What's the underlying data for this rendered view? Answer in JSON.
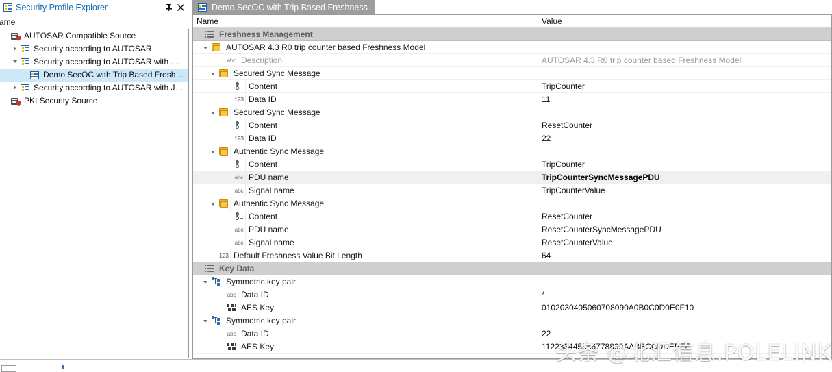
{
  "left_dock": {
    "title": "Security Profile Explorer",
    "title_icon": "security-profile-icon",
    "pin_glyph": "█",
    "close_glyph": "✕",
    "column_header": "ame",
    "tree": [
      {
        "label": "AUTOSAR Compatible Source",
        "icon": "source-icon",
        "indent": 0,
        "twisty": "none",
        "selected": false
      },
      {
        "label": "Security according to AUTOSAR",
        "icon": "profile-icon",
        "indent": 1,
        "twisty": "closed",
        "selected": false
      },
      {
        "label": "Security according to AUTOSAR with …",
        "icon": "profile-icon",
        "indent": 1,
        "twisty": "open",
        "selected": false
      },
      {
        "label": "Demo SecOC with  Trip Based Fresh…",
        "icon": "profile-leaf-icon",
        "indent": 2,
        "twisty": "none",
        "selected": true
      },
      {
        "label": "Security according to AUTOSAR with J…",
        "icon": "profile-icon",
        "indent": 1,
        "twisty": "closed",
        "selected": false
      },
      {
        "label": "PKI Security Source",
        "icon": "source-icon",
        "indent": 0,
        "twisty": "none",
        "selected": false
      }
    ]
  },
  "editor": {
    "tab": {
      "label": "Demo SecOC with Trip Based Freshness",
      "icon": "profile-leaf-icon",
      "active": true
    },
    "columns": {
      "name": "Name",
      "value": "Value"
    },
    "rows": [
      {
        "label": "Freshness Management",
        "value": "",
        "icon": "section-icon",
        "indent": 0,
        "twisty": "none",
        "kind": "section"
      },
      {
        "label": "AUTOSAR 4.3 R0 trip counter based Freshness Model",
        "value": "",
        "icon": "folder-icon",
        "indent": 1,
        "twisty": "open",
        "kind": "normal"
      },
      {
        "label": "Description",
        "value": "AUTOSAR 4.3 R0 trip counter based Freshness Model",
        "icon": "abc-icon",
        "indent": 3,
        "twisty": "none",
        "kind": "muted"
      },
      {
        "label": "Secured Sync Message",
        "value": "",
        "icon": "folder-icon",
        "indent": 2,
        "twisty": "open",
        "kind": "normal"
      },
      {
        "label": "Content",
        "value": "TripCounter",
        "icon": "enum-icon",
        "indent": 4,
        "twisty": "none",
        "kind": "normal"
      },
      {
        "label": "Data ID",
        "value": "11",
        "icon": "123-icon",
        "indent": 4,
        "twisty": "none",
        "kind": "normal"
      },
      {
        "label": "Secured Sync Message",
        "value": "",
        "icon": "folder-icon",
        "indent": 2,
        "twisty": "open",
        "kind": "normal"
      },
      {
        "label": "Content",
        "value": "ResetCounter",
        "icon": "enum-icon",
        "indent": 4,
        "twisty": "none",
        "kind": "normal"
      },
      {
        "label": "Data ID",
        "value": "22",
        "icon": "123-icon",
        "indent": 4,
        "twisty": "none",
        "kind": "normal"
      },
      {
        "label": "Authentic Sync Message",
        "value": "",
        "icon": "folder-icon",
        "indent": 2,
        "twisty": "open",
        "kind": "normal"
      },
      {
        "label": "Content",
        "value": "TripCounter",
        "icon": "enum-icon",
        "indent": 4,
        "twisty": "none",
        "kind": "normal"
      },
      {
        "label": "PDU name",
        "value": "TripCounterSyncMessagePDU",
        "icon": "abc-icon",
        "indent": 4,
        "twisty": "none",
        "kind": "highlight"
      },
      {
        "label": "Signal name",
        "value": "TripCounterValue",
        "icon": "abc-icon",
        "indent": 4,
        "twisty": "none",
        "kind": "normal"
      },
      {
        "label": "Authentic Sync Message",
        "value": "",
        "icon": "folder-icon",
        "indent": 2,
        "twisty": "open",
        "kind": "normal"
      },
      {
        "label": "Content",
        "value": "ResetCounter",
        "icon": "enum-icon",
        "indent": 4,
        "twisty": "none",
        "kind": "normal"
      },
      {
        "label": "PDU name",
        "value": "ResetCounterSyncMessagePDU",
        "icon": "abc-icon",
        "indent": 4,
        "twisty": "none",
        "kind": "normal"
      },
      {
        "label": "Signal name",
        "value": "ResetCounterValue",
        "icon": "abc-icon",
        "indent": 4,
        "twisty": "none",
        "kind": "normal"
      },
      {
        "label": "Default Freshness Value Bit Length",
        "value": "64",
        "icon": "123-icon",
        "indent": 2,
        "twisty": "none",
        "kind": "normal"
      },
      {
        "label": "Key Data",
        "value": "",
        "icon": "section-icon",
        "indent": 0,
        "twisty": "none",
        "kind": "section"
      },
      {
        "label": "Symmetric key pair",
        "value": "",
        "icon": "keypair-icon",
        "indent": 1,
        "twisty": "open",
        "kind": "normal"
      },
      {
        "label": "Data ID",
        "value": "*",
        "icon": "abc-icon",
        "indent": 3,
        "twisty": "none",
        "kind": "normal"
      },
      {
        "label": "AES Key",
        "value": "0102030405060708090A0B0C0D0E0F10",
        "icon": "hex-icon",
        "indent": 3,
        "twisty": "none",
        "kind": "normal"
      },
      {
        "label": "Symmetric key pair",
        "value": "",
        "icon": "keypair-icon",
        "indent": 1,
        "twisty": "open",
        "kind": "normal"
      },
      {
        "label": "Data ID",
        "value": "22",
        "icon": "abc-icon",
        "indent": 3,
        "twisty": "none",
        "kind": "normal"
      },
      {
        "label": "AES Key",
        "value": "112233445566778899AABBCCDDEEFF",
        "icon": "hex-icon",
        "indent": 3,
        "twisty": "none",
        "kind": "normal"
      }
    ]
  },
  "watermark": {
    "text": "头条 @北汇信息.POLELINK"
  },
  "colors": {
    "accent_blue": "#1a6fb4",
    "selection_blue": "#cde8f6",
    "section_gray": "#cfcfcf",
    "tab_gray": "#9d9d9d",
    "folder_yellow": "#f0b323"
  }
}
